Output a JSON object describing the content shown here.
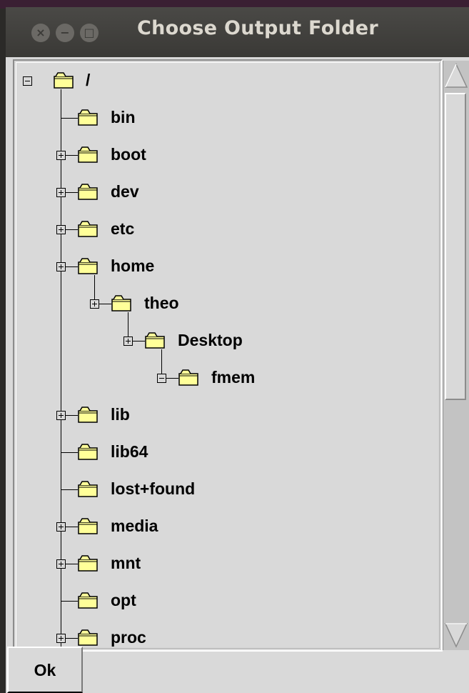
{
  "window": {
    "title": "Choose Output Folder",
    "controls": {
      "close": "×",
      "minimize": "−",
      "maximize": "□"
    }
  },
  "tree": {
    "root": {
      "label": "/",
      "expanded": true
    },
    "items": [
      {
        "label": "bin",
        "expander": "none",
        "depth": 1
      },
      {
        "label": "boot",
        "expander": "plus",
        "depth": 1
      },
      {
        "label": "dev",
        "expander": "plus",
        "depth": 1
      },
      {
        "label": "etc",
        "expander": "plus",
        "depth": 1
      },
      {
        "label": "home",
        "expander": "plus",
        "depth": 1
      },
      {
        "label": "theo",
        "expander": "plus",
        "depth": 2
      },
      {
        "label": "Desktop",
        "expander": "plus",
        "depth": 3
      },
      {
        "label": "fmem",
        "expander": "minus",
        "depth": 4
      },
      {
        "label": "lib",
        "expander": "plus",
        "depth": 1
      },
      {
        "label": "lib64",
        "expander": "none",
        "depth": 1
      },
      {
        "label": "lost+found",
        "expander": "none",
        "depth": 1
      },
      {
        "label": "media",
        "expander": "plus",
        "depth": 1
      },
      {
        "label": "mnt",
        "expander": "plus",
        "depth": 1
      },
      {
        "label": "opt",
        "expander": "none",
        "depth": 1
      },
      {
        "label": "proc",
        "expander": "plus",
        "depth": 1
      }
    ]
  },
  "buttons": {
    "ok": "Ok"
  },
  "colors": {
    "folder_fill": "#ffff99",
    "tree_background": "#d9d9d9",
    "titlebar": "#3c3b37"
  }
}
